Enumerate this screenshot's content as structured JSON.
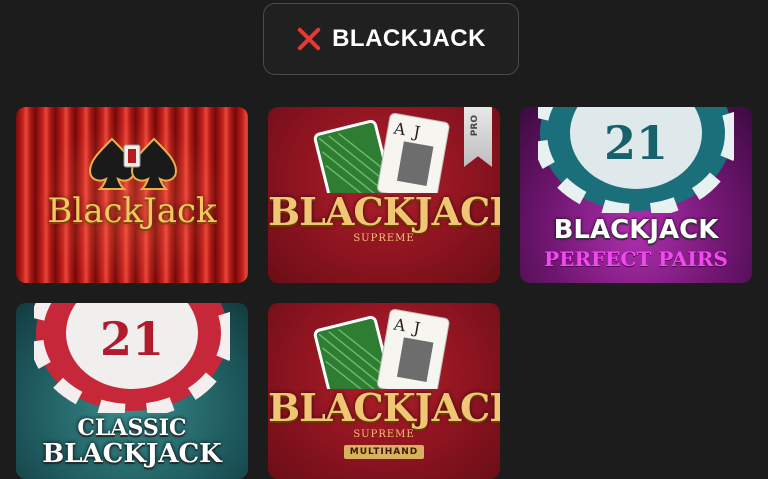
{
  "filter": {
    "label": "BLACKJACK",
    "clear_icon": "close-icon",
    "accent": "#e53935"
  },
  "games": [
    {
      "title": "BlackJack",
      "icon": "spades-icon"
    },
    {
      "title": "BLACKJACK",
      "subtitle": "SUPREME",
      "badge": "PRO"
    },
    {
      "title": "BLACKJACK",
      "subtitle": "PERFECT PAIRS",
      "chip_number": "21"
    },
    {
      "title_top": "CLASSIC",
      "title": "BLACKJACK",
      "chip_number": "21"
    },
    {
      "title": "BLACKJACK",
      "subtitle": "SUPREME",
      "tag": "MULTIHAND"
    }
  ],
  "cards": {
    "rank_a": "A",
    "rank_j": "J"
  }
}
